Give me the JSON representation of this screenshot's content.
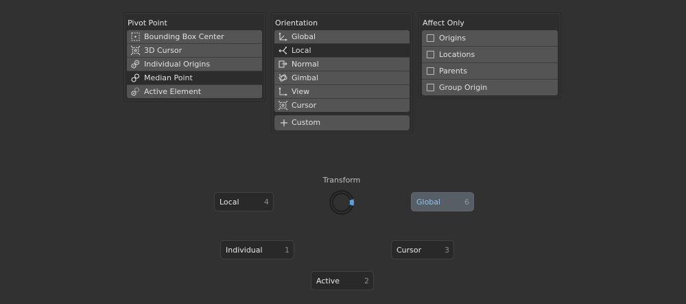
{
  "pivot_point": {
    "title": "Pivot Point",
    "items": [
      {
        "label": "Bounding Box Center",
        "icon": "bounding-box-center-icon",
        "active": false
      },
      {
        "label": "3D Cursor",
        "icon": "3d-cursor-icon",
        "active": false
      },
      {
        "label": "Individual Origins",
        "icon": "individual-origins-icon",
        "active": false
      },
      {
        "label": "Median Point",
        "icon": "median-point-icon",
        "active": true
      },
      {
        "label": "Active Element",
        "icon": "active-element-icon",
        "active": false
      }
    ]
  },
  "orientation": {
    "title": "Orientation",
    "items": [
      {
        "label": "Global",
        "icon": "global-axis-icon",
        "active": false
      },
      {
        "label": "Local",
        "icon": "local-axis-icon",
        "active": true
      },
      {
        "label": "Normal",
        "icon": "normal-axis-icon",
        "active": false
      },
      {
        "label": "Gimbal",
        "icon": "gimbal-icon",
        "active": false
      },
      {
        "label": "View",
        "icon": "view-axis-icon",
        "active": false
      },
      {
        "label": "Cursor",
        "icon": "cursor-axis-icon",
        "active": false
      }
    ],
    "custom_label": "Custom"
  },
  "affect_only": {
    "title": "Affect Only",
    "items": [
      {
        "label": "Origins",
        "checked": false
      },
      {
        "label": "Locations",
        "checked": false
      },
      {
        "label": "Parents",
        "checked": false
      },
      {
        "label": "Group Origin",
        "checked": false
      }
    ]
  },
  "pie_menu": {
    "title": "Transform",
    "buttons": {
      "local": {
        "label": "Local",
        "number": "4"
      },
      "global": {
        "label": "Global",
        "number": "6"
      },
      "individual": {
        "label": "Individual",
        "number": "1"
      },
      "cursor": {
        "label": "Cursor",
        "number": "3"
      },
      "active": {
        "label": "Active",
        "number": "2"
      }
    }
  },
  "colors": {
    "background": "#313131",
    "row": "#545454",
    "row_active": "#2c2c2c",
    "highlight_text": "#8fc6ee",
    "pie_indicator": "#5aa0d8"
  }
}
